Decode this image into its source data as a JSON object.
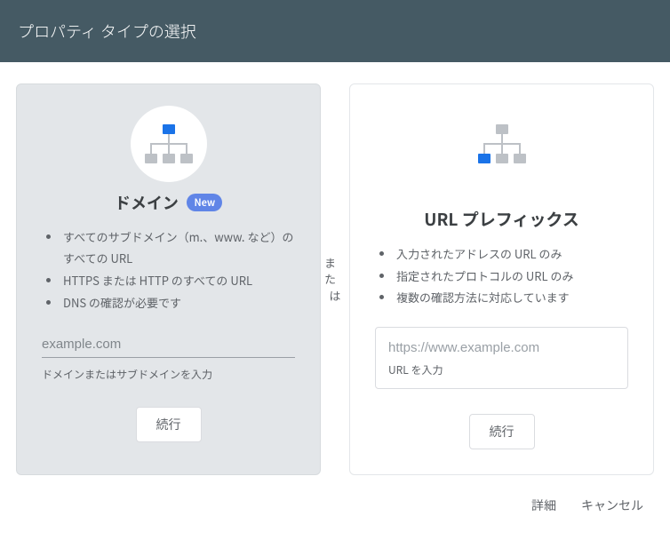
{
  "header": {
    "title": "プロパティ タイプの選択"
  },
  "separator": {
    "a": "また",
    "b": "は"
  },
  "cards": {
    "domain": {
      "title": "ドメイン",
      "badge": "New",
      "features": [
        "すべてのサブドメイン（m.、www. など）のすべての URL",
        "HTTPS または HTTP のすべての URL",
        "DNS の確認が必要です"
      ],
      "placeholder": "example.com",
      "hint": "ドメインまたはサブドメインを入力",
      "button": "続行"
    },
    "url": {
      "title": "URL プレフィックス",
      "features": [
        "入力されたアドレスの URL のみ",
        "指定されたプロトコルの URL のみ",
        "複数の確認方法に対応しています"
      ],
      "placeholder": "https://www.example.com",
      "hint": "URL を入力",
      "button": "続行"
    }
  },
  "footer": {
    "details": "詳細",
    "cancel": "キャンセル"
  }
}
